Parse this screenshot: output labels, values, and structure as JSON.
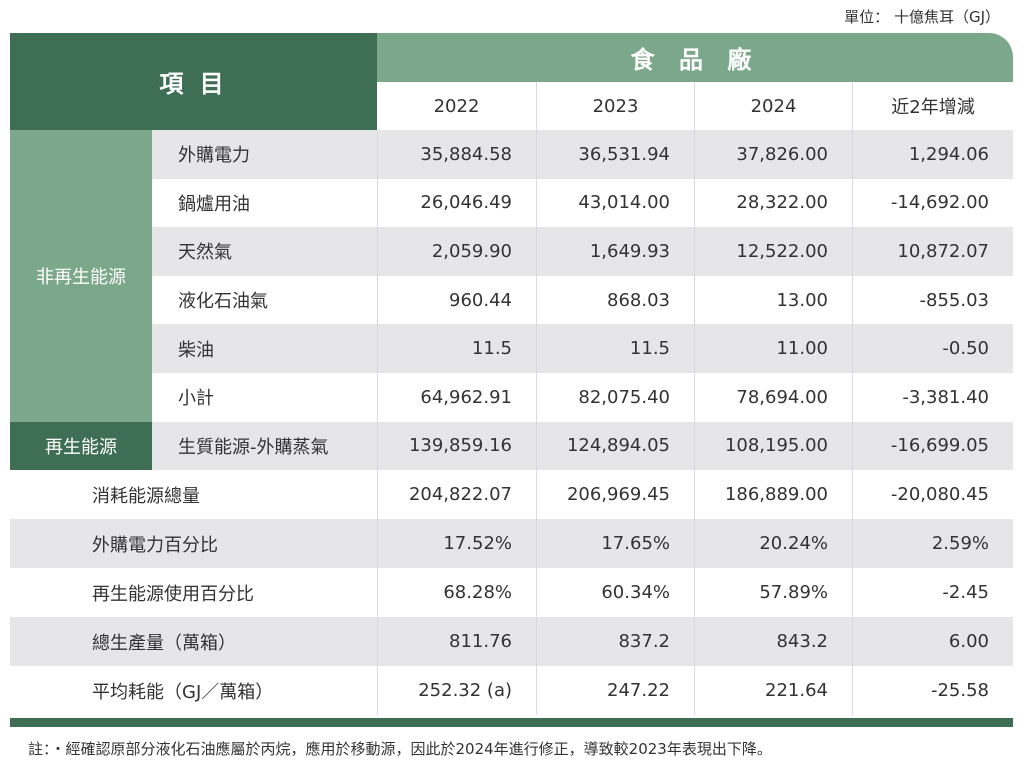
{
  "unit": "單位： 十億焦耳（GJ）",
  "header": {
    "item": "項 目",
    "factory": "食 品 廠",
    "years": [
      "2022",
      "2023",
      "2024",
      "近2年增減"
    ]
  },
  "categories": {
    "nonrenewable": "非再生能源",
    "renewable": "再生能源"
  },
  "rows": [
    {
      "name": "外購電力",
      "values": [
        "35,884.58",
        "36,531.94",
        "37,826.00",
        "1,294.06"
      ]
    },
    {
      "name": "鍋爐用油",
      "values": [
        "26,046.49",
        "43,014.00",
        "28,322.00",
        "-14,692.00"
      ]
    },
    {
      "name": "天然氣",
      "values": [
        "2,059.90",
        "1,649.93",
        "12,522.00",
        "10,872.07"
      ]
    },
    {
      "name": "液化石油氣",
      "values": [
        "960.44",
        "868.03",
        "13.00",
        "-855.03"
      ]
    },
    {
      "name": "柴油",
      "values": [
        "11.5",
        "11.5",
        "11.00",
        "-0.50"
      ]
    },
    {
      "name": "小計",
      "values": [
        "64,962.91",
        "82,075.40",
        "78,694.00",
        "-3,381.40"
      ]
    },
    {
      "name": "生質能源-外購蒸氣",
      "values": [
        "139,859.16",
        "124,894.05",
        "108,195.00",
        "-16,699.05"
      ]
    }
  ],
  "summary": [
    {
      "name": "消耗能源總量",
      "values": [
        "204,822.07",
        "206,969.45",
        "186,889.00",
        "-20,080.45"
      ]
    },
    {
      "name": "外購電力百分比",
      "values": [
        "17.52%",
        "17.65%",
        "20.24%",
        "2.59%"
      ]
    },
    {
      "name": "再生能源使用百分比",
      "values": [
        "68.28%",
        "60.34%",
        "57.89%",
        "-2.45"
      ]
    },
    {
      "name": "總生產量（萬箱）",
      "values": [
        "811.76",
        "837.2",
        "843.2",
        "6.00"
      ]
    },
    {
      "name": "平均耗能（GJ／萬箱）",
      "values": [
        "252.32 (a)",
        "247.22",
        "221.64",
        "-25.58"
      ]
    }
  ],
  "note": "註：・經確認原部分液化石油應屬於丙烷，應用於移動源，因此於2024年進行修正，導致較2023年表現出下降。",
  "colors": {
    "dark_green": "#3e6f54",
    "light_green": "#7ba88a",
    "shade": "#e6e6e8"
  }
}
